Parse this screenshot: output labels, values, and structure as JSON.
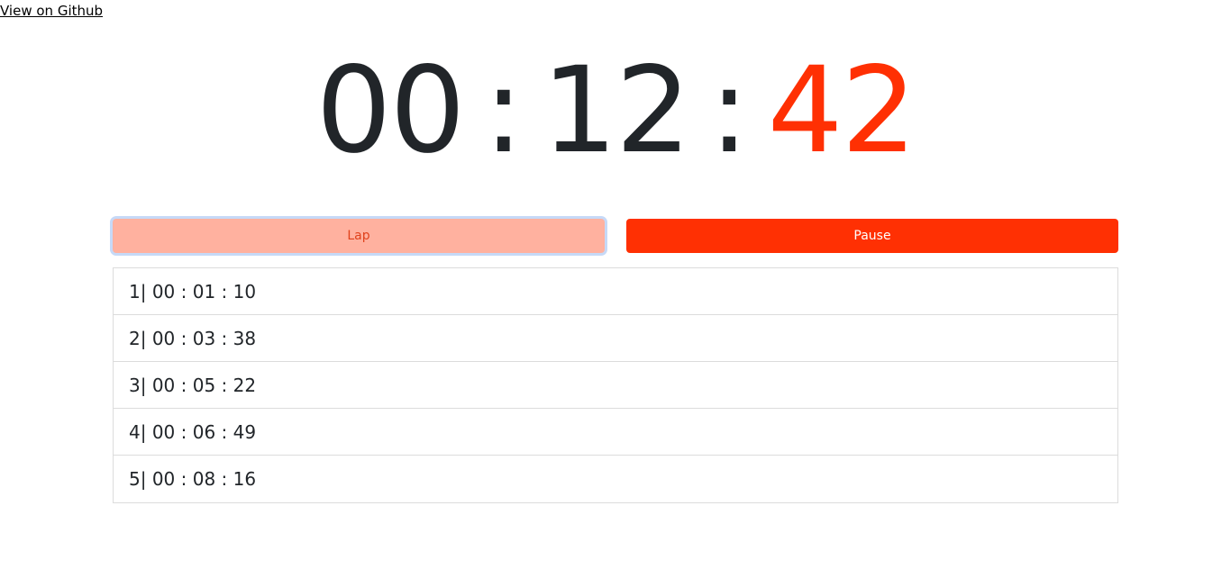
{
  "header": {
    "github_link": "View on Github"
  },
  "timer": {
    "hours": "00",
    "separator": ":",
    "minutes": "12",
    "seconds": "42"
  },
  "controls": {
    "lap_label": "Lap",
    "pause_label": "Pause"
  },
  "laps": [
    "1| 00 : 01 : 10",
    "2| 00 : 03 : 38",
    "3| 00 : 05 : 22",
    "4| 00 : 06 : 49",
    "5| 00 : 08 : 16"
  ],
  "colors": {
    "accent": "#ff3003",
    "lap_button_bg": "#ffb19f",
    "text": "#212529"
  }
}
